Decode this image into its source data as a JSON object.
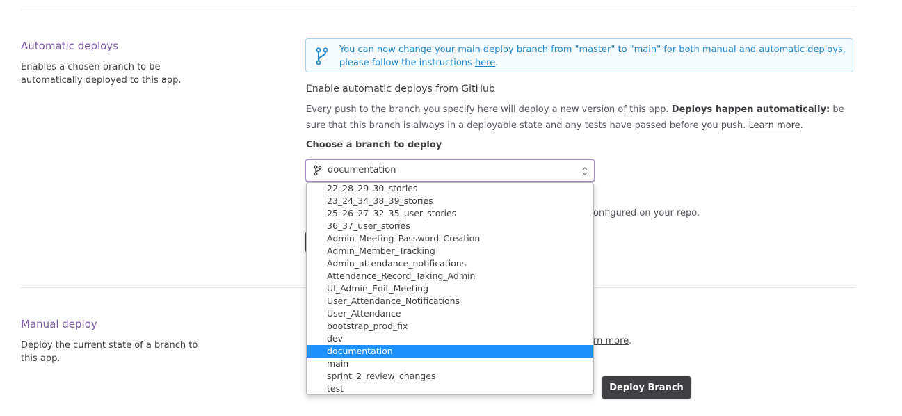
{
  "automatic": {
    "title": "Automatic deploys",
    "description": "Enables a chosen branch to be automatically deployed to this app.",
    "banner": {
      "text_before": "You can now change your main deploy branch from \"master\" to \"main\" for both manual and automatic deploys, please follow the instructions ",
      "link_text": "here",
      "text_after": "."
    },
    "subhead": "Enable automatic deploys from GitHub",
    "paragraph": {
      "part1": "Every push to the branch you specify here will deploy a new version of this app. ",
      "bold": "Deploys happen automatically:",
      "part2": " be sure that this branch is always in a deployable state and any tests have passed before you push. ",
      "link": "Learn more",
      "end": "."
    },
    "branch_label": "Choose a branch to deploy",
    "selected_branch": "documentation",
    "options": [
      "22_28_29_30_stories",
      "23_24_34_38_39_stories",
      "25_26_27_32_35_user_stories",
      "36_37_user_stories",
      "Admin_Meeting_Password_Creation",
      "Admin_Member_Tracking",
      "Admin_attendance_notifications",
      "Attendance_Record_Taking_Admin",
      "UI_Admin_Edit_Meeting",
      "User_Attendance_Notifications",
      "User_Attendance",
      "bootstrap_prod_fix",
      "dev",
      "documentation",
      "main",
      "sprint_2_review_changes",
      "test"
    ],
    "selected_index": 13,
    "obscured_ci_text": "onfigured on your repo."
  },
  "manual": {
    "title": "Manual deploy",
    "description": "Deploy the current state of a branch to this app.",
    "obscured_link": "rn more",
    "obscured_end": ".",
    "deploy_button": "Deploy Branch"
  },
  "icons": {
    "branch": "git-branch-icon",
    "caret": "select-caret-icon"
  },
  "colors": {
    "accent_purple": "#79589f",
    "info_blue": "#1f86c9",
    "selected_option": "#1e90ff",
    "button_dark": "#3f3f44"
  }
}
